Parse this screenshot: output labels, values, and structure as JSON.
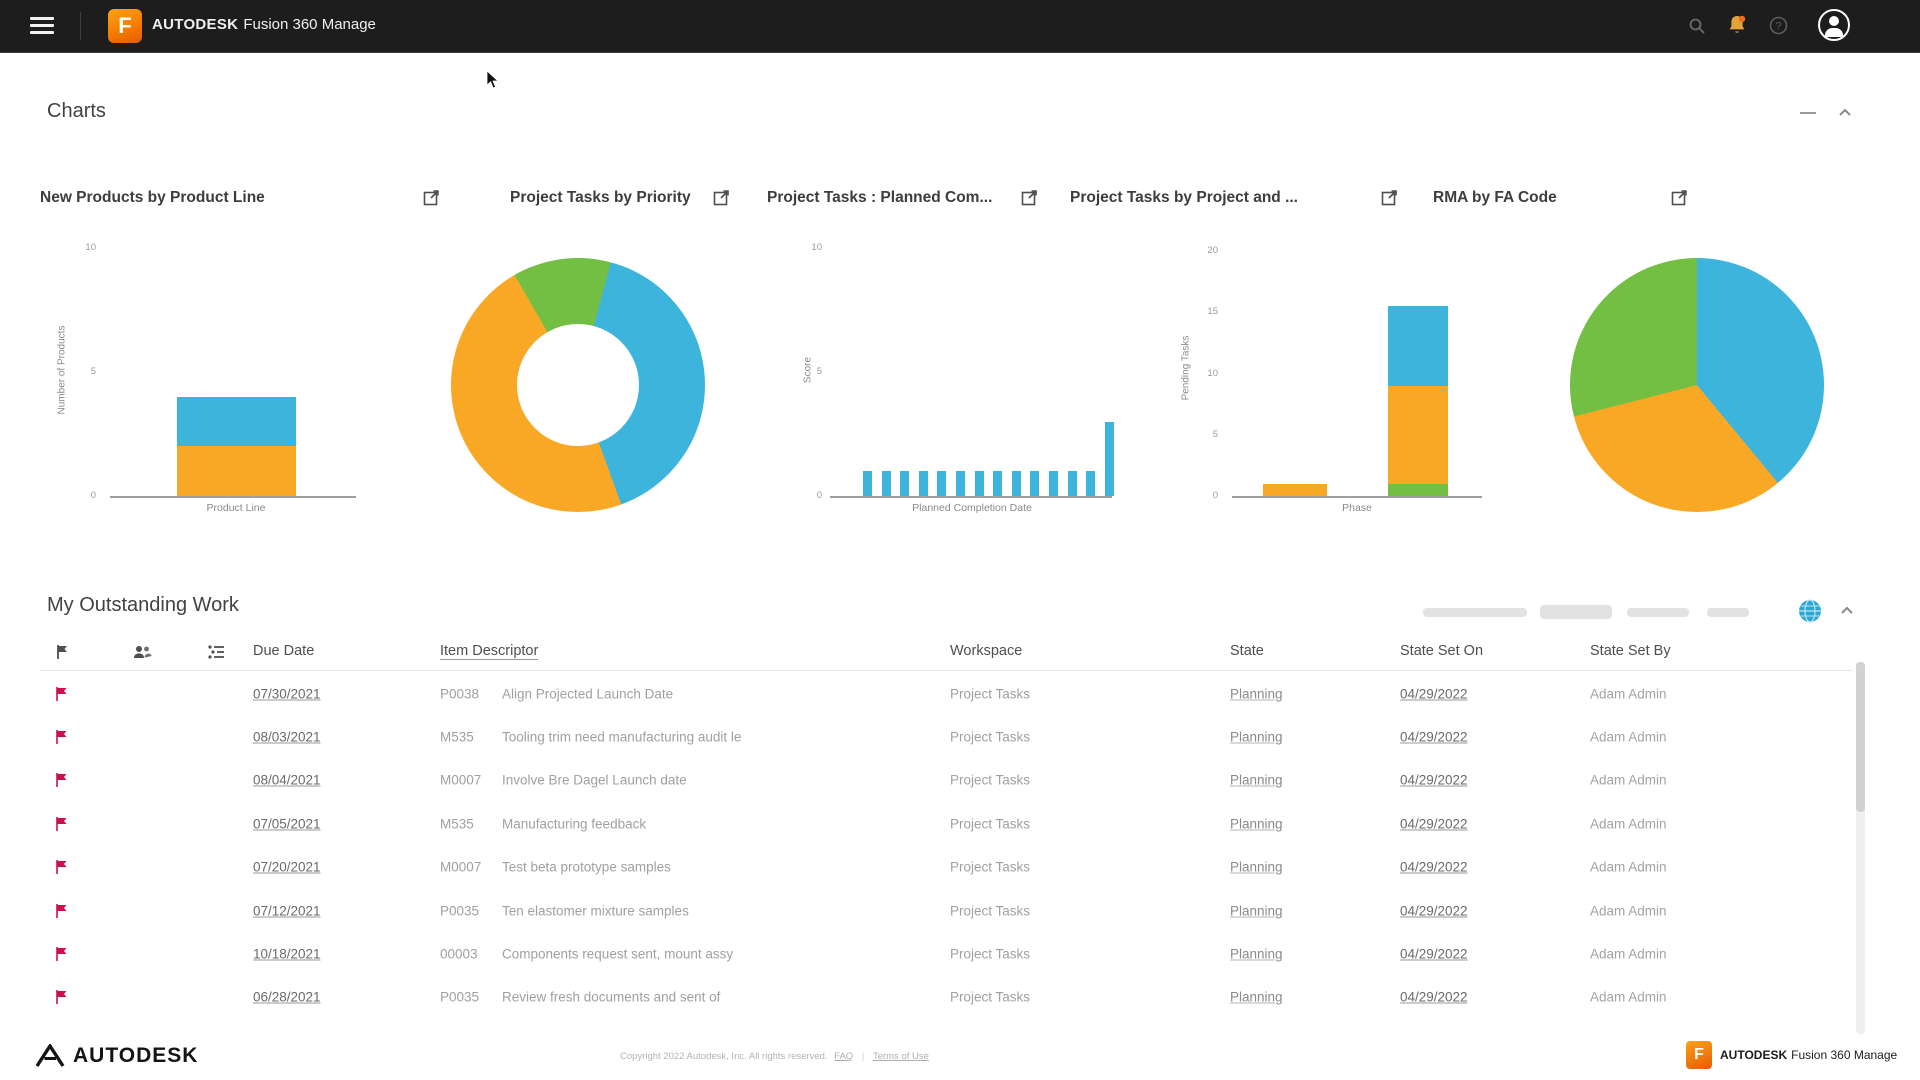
{
  "topbar": {
    "brand_bold": "AUTODESK",
    "brand_rest": "Fusion 360 Manage",
    "logo_letter": "F"
  },
  "charts_section": {
    "title": "Charts"
  },
  "chart_data": [
    {
      "type": "bar",
      "stacked": true,
      "title": "New Products by Product Line",
      "ylabel": "Number of Products",
      "xlabel": "Product Line",
      "ylim": [
        0,
        10
      ],
      "yticks": [
        0,
        5,
        10
      ],
      "grid": false,
      "bars": [
        {
          "segments": [
            {
              "name": "orange",
              "value": 2
            },
            {
              "name": "blue",
              "value": 2
            }
          ]
        }
      ]
    },
    {
      "type": "donut",
      "title": "Project Tasks by Priority",
      "rotate": 330,
      "slices": [
        {
          "name": "green",
          "pct": 12.5
        },
        {
          "name": "blue",
          "pct": 40.3
        },
        {
          "name": "orange",
          "pct": 47.2
        }
      ]
    },
    {
      "type": "bar",
      "stacked": false,
      "title": "Project Tasks : Planned Com...",
      "ylabel": "Score",
      "xlabel": "Planned Completion Date",
      "ylim": [
        0,
        10
      ],
      "yticks": [
        0,
        5,
        10
      ],
      "grid": false,
      "color": "blue",
      "values": [
        1,
        1,
        1,
        1,
        1,
        1,
        1,
        1,
        1,
        1,
        1,
        1,
        1,
        3
      ]
    },
    {
      "type": "bar",
      "stacked": true,
      "title": "Project Tasks by Project and ...",
      "ylabel": "Pending Tasks",
      "xlabel": "Phase",
      "ylim": [
        0,
        20
      ],
      "yticks": [
        0,
        5,
        10,
        15,
        20
      ],
      "grid": false,
      "bars": [
        {
          "segments": [
            {
              "name": "orange",
              "value": 1
            }
          ]
        },
        {
          "segments": [
            {
              "name": "green",
              "value": 1
            },
            {
              "name": "orange",
              "value": 8
            },
            {
              "name": "blue",
              "value": 6.5
            }
          ]
        }
      ]
    },
    {
      "type": "pie",
      "title": "RMA by FA Code",
      "rotate": 0,
      "slices": [
        {
          "name": "blue",
          "pct": 39
        },
        {
          "name": "orange",
          "pct": 32
        },
        {
          "name": "green",
          "pct": 29
        }
      ]
    }
  ],
  "work": {
    "title": "My Outstanding Work",
    "columns": [
      "Due Date",
      "Item Descriptor",
      "Workspace",
      "State",
      "State Set On",
      "State Set By"
    ],
    "rows": [
      {
        "due": "07/30/2021",
        "code": "P0038",
        "text": "Align Projected Launch Date",
        "workspace": "Project Tasks",
        "state": "Planning",
        "set_on": "04/29/2022",
        "set_by": "Adam Admin"
      },
      {
        "due": "08/03/2021",
        "code": "M535",
        "text": "Tooling trim need manufacturing audit le",
        "workspace": "Project Tasks",
        "state": "Planning",
        "set_on": "04/29/2022",
        "set_by": "Adam Admin"
      },
      {
        "due": "08/04/2021",
        "code": "M0007",
        "text": "Involve Bre Dagel Launch date",
        "workspace": "Project Tasks",
        "state": "Planning",
        "set_on": "04/29/2022",
        "set_by": "Adam Admin"
      },
      {
        "due": "07/05/2021",
        "code": "M535",
        "text": "Manufacturing feedback",
        "workspace": "Project Tasks",
        "state": "Planning",
        "set_on": "04/29/2022",
        "set_by": "Adam Admin"
      },
      {
        "due": "07/20/2021",
        "code": "M0007",
        "text": "Test beta prototype samples",
        "workspace": "Project Tasks",
        "state": "Planning",
        "set_on": "04/29/2022",
        "set_by": "Adam Admin"
      },
      {
        "due": "07/12/2021",
        "code": "P0035",
        "text": "Ten elastomer mixture samples",
        "workspace": "Project Tasks",
        "state": "Planning",
        "set_on": "04/29/2022",
        "set_by": "Adam Admin"
      },
      {
        "due": "10/18/2021",
        "code": "00003",
        "text": "Components request sent, mount assy",
        "workspace": "Project Tasks",
        "state": "Planning",
        "set_on": "04/29/2022",
        "set_by": "Adam Admin"
      },
      {
        "due": "06/28/2021",
        "code": "P0035",
        "text": "Review fresh documents and sent of",
        "workspace": "Project Tasks",
        "state": "Planning",
        "set_on": "04/29/2022",
        "set_by": "Adam Admin"
      }
    ]
  },
  "footer": {
    "logo_text": "AUTODESK",
    "copyright": "Copyright 2022 Autodesk, Inc. All rights reserved.",
    "links": [
      "FAQ",
      "Terms of Use"
    ],
    "brand_bold": "AUTODESK",
    "brand_rest": "Fusion 360 Manage"
  },
  "colors": {
    "orange": "#F9A825",
    "blue": "#3CB4DC",
    "green": "#72BF44",
    "flag": "#CE0F4F",
    "fusion_orange": "#F57C00",
    "topbar_bg": "#1D1D1D",
    "globe_blue": "#2FA7D4"
  }
}
